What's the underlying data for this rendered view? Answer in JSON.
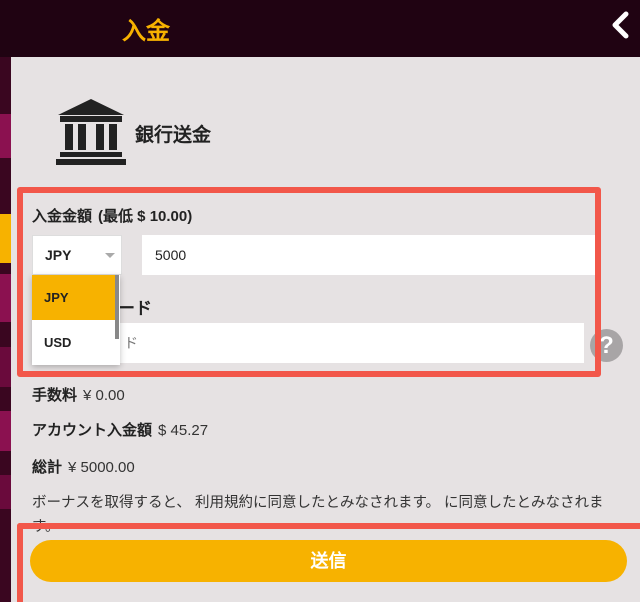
{
  "header": {
    "title": "入金",
    "back_icon": "chevron-left-icon"
  },
  "method": {
    "label": "銀行送金",
    "icon": "bank-icon"
  },
  "amount": {
    "label": "入金金額",
    "min_text": "(最低 $ 10.00)",
    "currency_selected": "JPY",
    "value": "5000"
  },
  "currency_dropdown": {
    "options": [
      "JPY",
      "USD"
    ]
  },
  "bonus": {
    "label_partial": "ード",
    "placeholder_partial": "ド"
  },
  "summary": {
    "fee_label": "手数料",
    "fee_value": "¥ 0.00",
    "account_label": "アカウント入金額",
    "account_value": "$ 45.27",
    "total_label": "総計",
    "total_value": "¥ 5000.00"
  },
  "terms": {
    "text": "ボーナスを取得すると、 利用規約に同意したとみなされます。 に同意したとみなされます。"
  },
  "submit": {
    "label": "送信"
  },
  "colors": {
    "accent": "#f7b200",
    "header_bg": "#200312",
    "highlight": "#f2574a"
  }
}
